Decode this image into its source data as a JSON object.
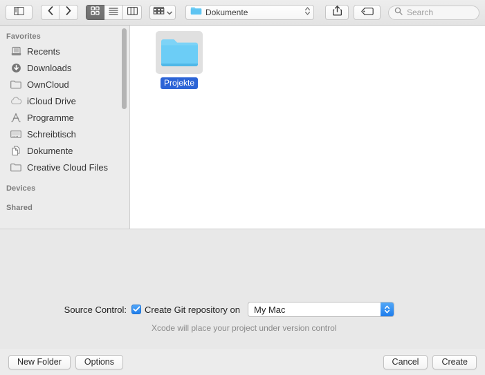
{
  "toolbar": {
    "sidebar_toggle_icon": "sidebar-toggle-icon",
    "back_icon": "chevron-left-icon",
    "forward_icon": "chevron-right-icon",
    "view_icon_grid": "icon-view-icon",
    "view_list": "list-view-icon",
    "view_columns": "column-view-icon",
    "arrange_icon": "arrange-grid-icon",
    "arrange_chevron": "chevron-down-icon",
    "path_label": "Dokumente",
    "path_folder_icon": "folder-icon",
    "path_chevrons_icon": "chevron-up-down-icon",
    "share_icon": "share-icon",
    "tag_icon": "tag-icon",
    "search_icon": "search-icon",
    "search_placeholder": "Search",
    "search_value": ""
  },
  "sidebar": {
    "sections": [
      {
        "header": "Favorites",
        "items": [
          {
            "label": "Recents",
            "icon": "recents-icon"
          },
          {
            "label": "Downloads",
            "icon": "downloads-icon"
          },
          {
            "label": "OwnCloud",
            "icon": "folder-icon"
          },
          {
            "label": "iCloud Drive",
            "icon": "icloud-icon"
          },
          {
            "label": "Programme",
            "icon": "applications-icon"
          },
          {
            "label": "Schreibtisch",
            "icon": "desktop-icon"
          },
          {
            "label": "Dokumente",
            "icon": "documents-icon"
          },
          {
            "label": "Creative Cloud Files",
            "icon": "folder-icon"
          }
        ]
      },
      {
        "header": "Devices",
        "items": []
      },
      {
        "header": "Shared",
        "items": []
      }
    ]
  },
  "content": {
    "files": [
      {
        "name": "Projekte",
        "icon": "folder-icon",
        "selected": true
      }
    ]
  },
  "accessory": {
    "source_control_label": "Source Control:",
    "checkbox_checked": true,
    "checkbox_label": "Create Git repository on",
    "popup_value": "My Mac",
    "popup_chevron_icon": "chevron-up-down-icon",
    "hint": "Xcode will place your project under version control"
  },
  "bottombar": {
    "new_folder_label": "New Folder",
    "options_label": "Options",
    "cancel_label": "Cancel",
    "create_label": "Create"
  },
  "colors": {
    "selection_blue": "#2c64d6",
    "control_blue": "#1d7cec",
    "toolbar_bg": "#e8e8e8",
    "sidebar_bg": "#ececec"
  }
}
